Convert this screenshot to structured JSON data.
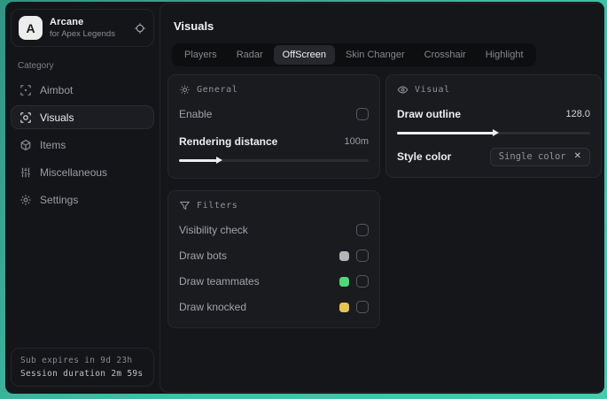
{
  "colors": {
    "accent_teal": "#3fbfa3",
    "window_bg": "#141519",
    "panel_bg": "#1a1b1f",
    "swatch_bots": "#b5b5b5",
    "swatch_teammates": "#4cd977",
    "swatch_knocked": "#e5c44f"
  },
  "sidebar": {
    "app": {
      "logo_letter": "A",
      "name": "Arcane",
      "subtitle": "for Apex Legends"
    },
    "category_label": "Category",
    "items": [
      {
        "label": "Aimbot",
        "icon": "crosshair-icon",
        "active": false
      },
      {
        "label": "Visuals",
        "icon": "scan-eye-icon",
        "active": true
      },
      {
        "label": "Items",
        "icon": "box-icon",
        "active": false
      },
      {
        "label": "Miscellaneous",
        "icon": "sliders-icon",
        "active": false
      },
      {
        "label": "Settings",
        "icon": "gear-icon",
        "active": false
      }
    ],
    "footer": {
      "sub_expires": "Sub expires in 9d 23h",
      "session_duration": "Session duration 2m 59s"
    }
  },
  "main": {
    "title": "Visuals",
    "tabs": [
      {
        "label": "Players",
        "active": false
      },
      {
        "label": "Radar",
        "active": false
      },
      {
        "label": "OffScreen",
        "active": true
      },
      {
        "label": "Skin Changer",
        "active": false
      },
      {
        "label": "Crosshair",
        "active": false
      },
      {
        "label": "Highlight",
        "active": false
      }
    ],
    "general": {
      "title": "General",
      "enable_label": "Enable",
      "enable_checked": false,
      "rendering_distance_label": "Rendering distance",
      "rendering_distance_value": "100m",
      "rendering_distance_fill": "20%"
    },
    "visual": {
      "title": "Visual",
      "draw_outline_label": "Draw outline",
      "draw_outline_value": "128.0",
      "draw_outline_fill": "50%",
      "style_color_label": "Style color",
      "style_color_value": "Single color",
      "clear_label": "✕"
    },
    "filters": {
      "title": "Filters",
      "rows": [
        {
          "label": "Visibility check",
          "checked": false
        },
        {
          "label": "Draw bots",
          "swatch": "#b5b5b5",
          "checked": false
        },
        {
          "label": "Draw teammates",
          "swatch": "#4cd977",
          "checked": false
        },
        {
          "label": "Draw knocked",
          "swatch": "#e5c44f",
          "checked": false
        }
      ]
    }
  }
}
